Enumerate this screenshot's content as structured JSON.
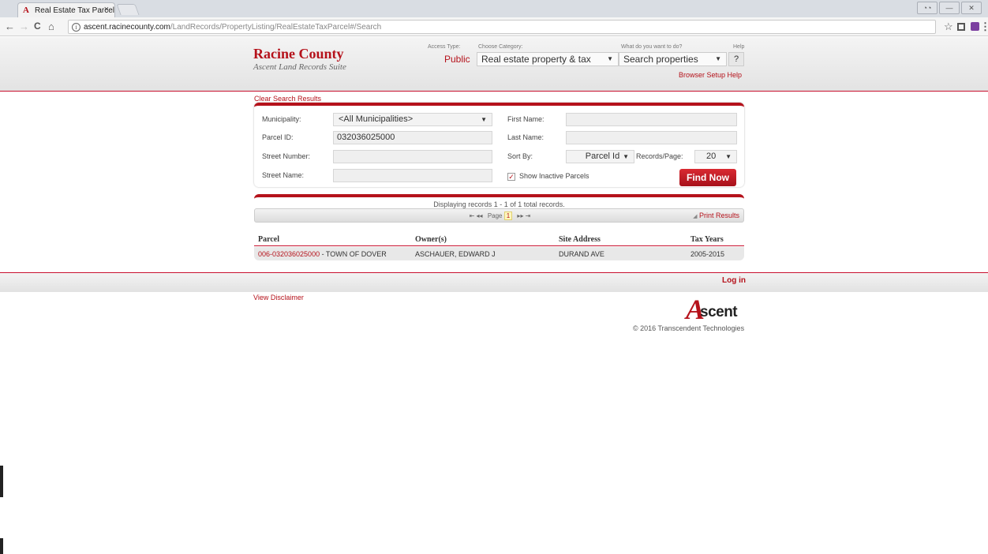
{
  "browser": {
    "tab_title": "Real Estate Tax Parcel",
    "tab_close": "×",
    "url_host": "ascent.racinecounty.com",
    "url_path": "/LandRecords/PropertyListing/RealEstateTaxParcel#/Search",
    "back": "←",
    "forward": "→",
    "reload": "C",
    "home": "⌂",
    "star": "☆"
  },
  "header": {
    "title": "Racine County",
    "subtitle": "Ascent Land Records Suite",
    "access_type_label": "Access Type:",
    "access_type_value": "Public",
    "category_label": "Choose Category:",
    "category_value": "Real estate property & tax",
    "action_label": "What do you want to do?",
    "action_value": "Search properties",
    "help_label": "Help",
    "help_button": "?",
    "browser_setup_help": "Browser Setup Help"
  },
  "search": {
    "clear_results": "Clear Search Results",
    "municipality_label": "Municipality:",
    "municipality_value": "<All Municipalities>",
    "parcel_id_label": "Parcel ID:",
    "parcel_id_value": "032036025000",
    "street_number_label": "Street Number:",
    "street_number_value": "",
    "street_name_label": "Street Name:",
    "street_name_value": "",
    "first_name_label": "First Name:",
    "first_name_value": "",
    "last_name_label": "Last Name:",
    "last_name_value": "",
    "sort_by_label": "Sort By:",
    "sort_by_value": "Parcel Id",
    "records_per_page_label": "Records/Page:",
    "records_per_page_value": "20",
    "show_inactive_label": "Show Inactive Parcels",
    "show_inactive_checked": "✓",
    "find_now": "Find Now"
  },
  "results": {
    "display_text": "Displaying records 1 - 1 of 1 total records.",
    "pager_first": "⇤ ◂◂",
    "page_label": "Page",
    "page_number": "1",
    "pager_last": "▸▸ ⇥",
    "print_results": "Print Results",
    "columns": [
      "Parcel",
      "Owner(s)",
      "Site Address",
      "Tax Years"
    ],
    "rows": [
      {
        "parcel_link": "006-032036025000",
        "parcel_suffix": " - TOWN OF DOVER",
        "owner": "ASCHAUER, EDWARD J",
        "site_address": "DURAND AVE",
        "tax_years": "2005-2015"
      }
    ]
  },
  "footer": {
    "login": "Log in",
    "disclaimer": "View Disclaimer",
    "logo_letter": "A",
    "logo_text": "scent",
    "copyright": "© 2016 Transcendent Technologies"
  },
  "colors": {
    "accent": "#b5121b"
  }
}
